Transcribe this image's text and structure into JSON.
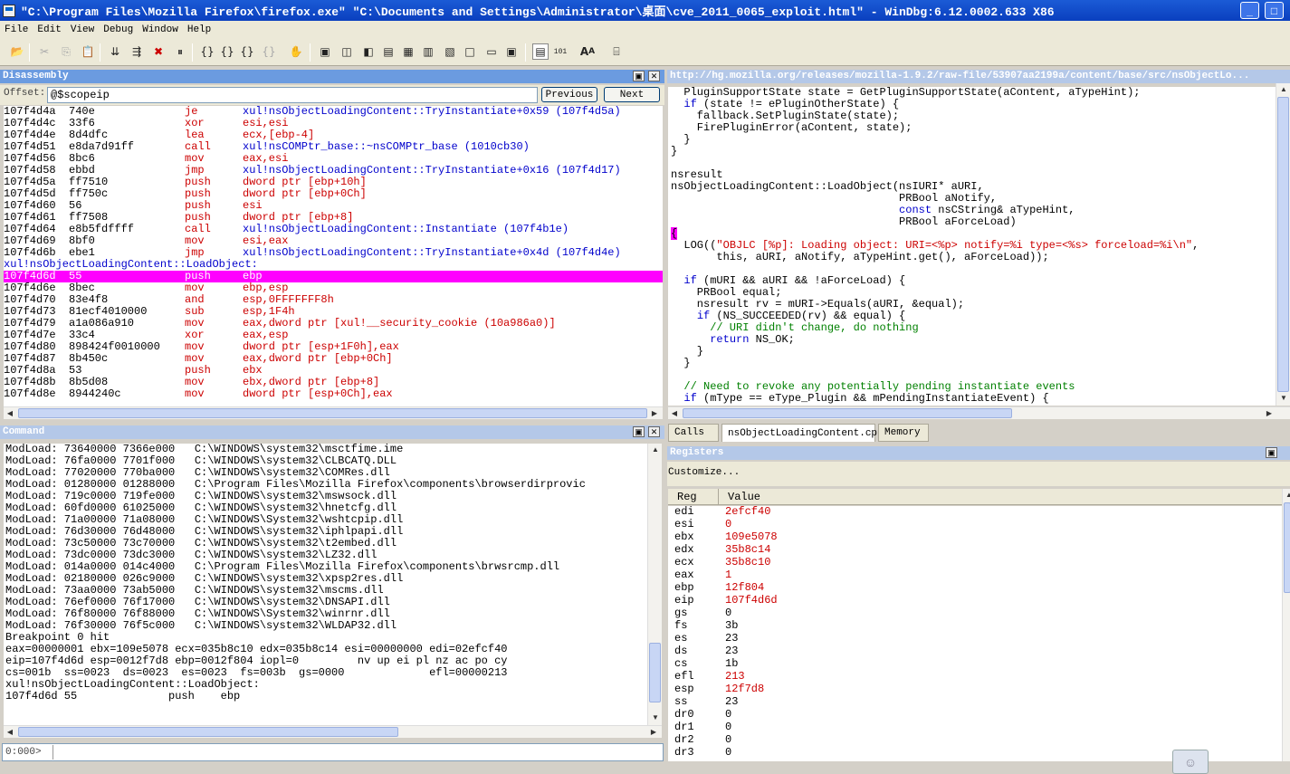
{
  "window": {
    "title": "\"C:\\Program Files\\Mozilla Firefox\\firefox.exe\"  \"C:\\Documents and Settings\\Administrator\\桌面\\cve_2011_0065_exploit.html\" - WinDbg:6.12.0002.633 X86"
  },
  "menu": [
    "File",
    "Edit",
    "View",
    "Debug",
    "Window",
    "Help"
  ],
  "disassembly": {
    "title": "Disassembly",
    "offset_label": "Offset:",
    "offset_value": "@$scopeip",
    "prev_label": "Previous",
    "next_label": "Next",
    "rows": [
      {
        "addr": "107f4d4a",
        "bytes": "740e",
        "op": "je",
        "args": "xul!nsObjectLoadingContent::TryInstantiate+0x59 (107f4d5a)",
        "kind": "jump"
      },
      {
        "addr": "107f4d4c",
        "bytes": "33f6",
        "op": "xor",
        "args": "esi,esi",
        "kind": "normal"
      },
      {
        "addr": "107f4d4e",
        "bytes": "8d4dfc",
        "op": "lea",
        "args": "ecx,[ebp-4]",
        "kind": "normal"
      },
      {
        "addr": "107f4d51",
        "bytes": "e8da7d91ff",
        "op": "call",
        "args": "xul!nsCOMPtr_base::~nsCOMPtr_base (1010cb30)",
        "kind": "jump"
      },
      {
        "addr": "107f4d56",
        "bytes": "8bc6",
        "op": "mov",
        "args": "eax,esi",
        "kind": "normal"
      },
      {
        "addr": "107f4d58",
        "bytes": "ebbd",
        "op": "jmp",
        "args": "xul!nsObjectLoadingContent::TryInstantiate+0x16 (107f4d17)",
        "kind": "jump"
      },
      {
        "addr": "107f4d5a",
        "bytes": "ff7510",
        "op": "push",
        "args": "dword ptr [ebp+10h]",
        "kind": "normal"
      },
      {
        "addr": "107f4d5d",
        "bytes": "ff750c",
        "op": "push",
        "args": "dword ptr [ebp+0Ch]",
        "kind": "normal"
      },
      {
        "addr": "107f4d60",
        "bytes": "56",
        "op": "push",
        "args": "esi",
        "kind": "normal"
      },
      {
        "addr": "107f4d61",
        "bytes": "ff7508",
        "op": "push",
        "args": "dword ptr [ebp+8]",
        "kind": "normal"
      },
      {
        "addr": "107f4d64",
        "bytes": "e8b5fdffff",
        "op": "call",
        "args": "xul!nsObjectLoadingContent::Instantiate (107f4b1e)",
        "kind": "jump"
      },
      {
        "addr": "107f4d69",
        "bytes": "8bf0",
        "op": "mov",
        "args": "esi,eax",
        "kind": "normal"
      },
      {
        "addr": "107f4d6b",
        "bytes": "ebe1",
        "op": "jmp",
        "args": "xul!nsObjectLoadingContent::TryInstantiate+0x4d (107f4d4e)",
        "kind": "jump"
      },
      {
        "addr": "xul!nsObjectLoadingContent::LoadObject:",
        "bytes": "",
        "op": "",
        "args": "",
        "kind": "label"
      },
      {
        "addr": "107f4d6d",
        "bytes": "55",
        "op": "push",
        "args": "ebp",
        "kind": "current"
      },
      {
        "addr": "107f4d6e",
        "bytes": "8bec",
        "op": "mov",
        "args": "ebp,esp",
        "kind": "normal"
      },
      {
        "addr": "107f4d70",
        "bytes": "83e4f8",
        "op": "and",
        "args": "esp,0FFFFFFF8h",
        "kind": "normal"
      },
      {
        "addr": "107f4d73",
        "bytes": "81ecf4010000",
        "op": "sub",
        "args": "esp,1F4h",
        "kind": "normal"
      },
      {
        "addr": "107f4d79",
        "bytes": "a1a086a910",
        "op": "mov",
        "args": "eax,dword ptr [xul!__security_cookie (10a986a0)]",
        "kind": "normal"
      },
      {
        "addr": "107f4d7e",
        "bytes": "33c4",
        "op": "xor",
        "args": "eax,esp",
        "kind": "normal"
      },
      {
        "addr": "107f4d80",
        "bytes": "898424f0010000",
        "op": "mov",
        "args": "dword ptr [esp+1F0h],eax",
        "kind": "normal"
      },
      {
        "addr": "107f4d87",
        "bytes": "8b450c",
        "op": "mov",
        "args": "eax,dword ptr [ebp+0Ch]",
        "kind": "normal"
      },
      {
        "addr": "107f4d8a",
        "bytes": "53",
        "op": "push",
        "args": "ebx",
        "kind": "normal"
      },
      {
        "addr": "107f4d8b",
        "bytes": "8b5d08",
        "op": "mov",
        "args": "ebx,dword ptr [ebp+8]",
        "kind": "normal"
      },
      {
        "addr": "107f4d8e",
        "bytes": "8944240c",
        "op": "mov",
        "args": "dword ptr [esp+0Ch],eax",
        "kind": "normal"
      }
    ]
  },
  "source": {
    "title": "http://hg.mozilla.org/releases/mozilla-1.9.2/raw-file/53907aa2199a/content/base/src/nsObjectLo...",
    "lines": [
      "  PluginSupportState state = GetPluginSupportState(aContent, aTypeHint);",
      "  if (state != ePluginOtherState) {",
      "    fallback.SetPluginState(state);",
      "    FirePluginError(aContent, state);",
      "  }",
      "}",
      "",
      "nsresult",
      "nsObjectLoadingContent::LoadObject(nsIURI* aURI,",
      "                                   PRBool aNotify,",
      "                                   const nsCString& aTypeHint,",
      "                                   PRBool aForceLoad)",
      "{",
      "  LOG((\"OBJLC [%p]: Loading object: URI=<%p> notify=%i type=<%s> forceload=%i\\n\",",
      "       this, aURI, aNotify, aTypeHint.get(), aForceLoad));",
      "",
      "  if (mURI && aURI && !aForceLoad) {",
      "    PRBool equal;",
      "    nsresult rv = mURI->Equals(aURI, &equal);",
      "    if (NS_SUCCEEDED(rv) && equal) {",
      "      // URI didn't change, do nothing",
      "      return NS_OK;",
      "    }",
      "  }",
      "",
      "  // Need to revoke any potentially pending instantiate events",
      "  if (mType == eType_Plugin && mPendingInstantiateEvent) {"
    ],
    "tabs": [
      "Calls",
      "nsObjectLoadingContent.cpp",
      "Memory"
    ]
  },
  "command": {
    "title": "Command",
    "lines": [
      "ModLoad: 73640000 7366e000   C:\\WINDOWS\\system32\\msctfime.ime",
      "ModLoad: 76fa0000 7701f000   C:\\WINDOWS\\system32\\CLBCATQ.DLL",
      "ModLoad: 77020000 770ba000   C:\\WINDOWS\\system32\\COMRes.dll",
      "ModLoad: 01280000 01288000   C:\\Program Files\\Mozilla Firefox\\components\\browserdirprovic",
      "ModLoad: 719c0000 719fe000   C:\\WINDOWS\\system32\\mswsock.dll",
      "ModLoad: 60fd0000 61025000   C:\\WINDOWS\\system32\\hnetcfg.dll",
      "ModLoad: 71a00000 71a08000   C:\\WINDOWS\\System32\\wshtcpip.dll",
      "ModLoad: 76d30000 76d48000   C:\\WINDOWS\\system32\\iphlpapi.dll",
      "ModLoad: 73c50000 73c70000   C:\\WINDOWS\\system32\\t2embed.dll",
      "ModLoad: 73dc0000 73dc3000   C:\\WINDOWS\\system32\\LZ32.dll",
      "ModLoad: 014a0000 014c4000   C:\\Program Files\\Mozilla Firefox\\components\\brwsrcmp.dll",
      "ModLoad: 02180000 026c9000   C:\\WINDOWS\\system32\\xpsp2res.dll",
      "ModLoad: 73aa0000 73ab5000   C:\\WINDOWS\\system32\\mscms.dll",
      "ModLoad: 76ef0000 76f17000   C:\\WINDOWS\\system32\\DNSAPI.dll",
      "ModLoad: 76f80000 76f88000   C:\\WINDOWS\\System32\\winrnr.dll",
      "ModLoad: 76f30000 76f5c000   C:\\WINDOWS\\system32\\WLDAP32.dll",
      "Breakpoint 0 hit",
      "eax=00000001 ebx=109e5078 ecx=035b8c10 edx=035b8c14 esi=00000000 edi=02efcf40",
      "eip=107f4d6d esp=0012f7d8 ebp=0012f804 iopl=0         nv up ei pl nz ac po cy",
      "cs=001b  ss=0023  ds=0023  es=0023  fs=003b  gs=0000             efl=00000213",
      "xul!nsObjectLoadingContent::LoadObject:",
      "107f4d6d 55              push    ebp"
    ],
    "prompt": "0:000>",
    "input_value": ""
  },
  "registers": {
    "title": "Registers",
    "customize_label": "Customize...",
    "col_reg": "Reg",
    "col_value": "Value",
    "rows": [
      {
        "reg": "edi",
        "value": "2efcf40",
        "changed": true
      },
      {
        "reg": "esi",
        "value": "0",
        "changed": true
      },
      {
        "reg": "ebx",
        "value": "109e5078",
        "changed": true
      },
      {
        "reg": "edx",
        "value": "35b8c14",
        "changed": true
      },
      {
        "reg": "ecx",
        "value": "35b8c10",
        "changed": true
      },
      {
        "reg": "eax",
        "value": "1",
        "changed": true
      },
      {
        "reg": "ebp",
        "value": "12f804",
        "changed": true
      },
      {
        "reg": "eip",
        "value": "107f4d6d",
        "changed": true
      },
      {
        "reg": "gs",
        "value": "0",
        "changed": false
      },
      {
        "reg": "fs",
        "value": "3b",
        "changed": false
      },
      {
        "reg": "es",
        "value": "23",
        "changed": false
      },
      {
        "reg": "ds",
        "value": "23",
        "changed": false
      },
      {
        "reg": "cs",
        "value": "1b",
        "changed": false
      },
      {
        "reg": "efl",
        "value": "213",
        "changed": true
      },
      {
        "reg": "esp",
        "value": "12f7d8",
        "changed": true
      },
      {
        "reg": "ss",
        "value": "23",
        "changed": false
      },
      {
        "reg": "dr0",
        "value": "0",
        "changed": false
      },
      {
        "reg": "dr1",
        "value": "0",
        "changed": false
      },
      {
        "reg": "dr2",
        "value": "0",
        "changed": false
      },
      {
        "reg": "dr3",
        "value": "0",
        "changed": false
      }
    ]
  },
  "colors": {
    "highlight": "#ff00ff",
    "changed": "#cc0000",
    "keyword": "#0000cc",
    "comment": "#008000"
  }
}
